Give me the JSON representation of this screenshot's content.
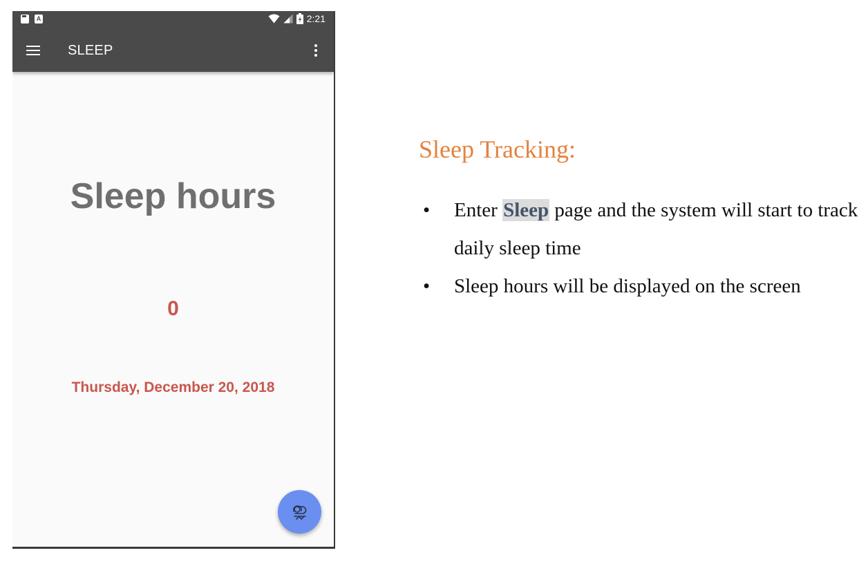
{
  "status_bar": {
    "time": "2:21",
    "left_icons": [
      "sd-card-icon",
      "a-badge-icon"
    ],
    "a_badge_text": "A",
    "right_icons": [
      "wifi-icon",
      "signal-icon",
      "battery-icon"
    ]
  },
  "app_bar": {
    "title": "SLEEP",
    "menu_icon": "hamburger-menu-icon",
    "overflow_icon": "more-vert-icon",
    "background": "#4a4a4a"
  },
  "main": {
    "heading": "Sleep hours",
    "hours_value": "0",
    "date": "Thursday, December 20, 2018",
    "accent_color": "#c9574d"
  },
  "fab": {
    "icon": "sleeping-person-icon",
    "color": "#6a8ff0"
  },
  "document": {
    "title": "Sleep Tracking:",
    "title_color": "#e4823e",
    "bullet_symbol": "•",
    "bullets": [
      {
        "before": "Enter ",
        "highlight": "Sleep",
        "after": " page and the system will start to track daily sleep time"
      },
      {
        "text": "Sleep hours will be displayed on the screen"
      }
    ]
  }
}
